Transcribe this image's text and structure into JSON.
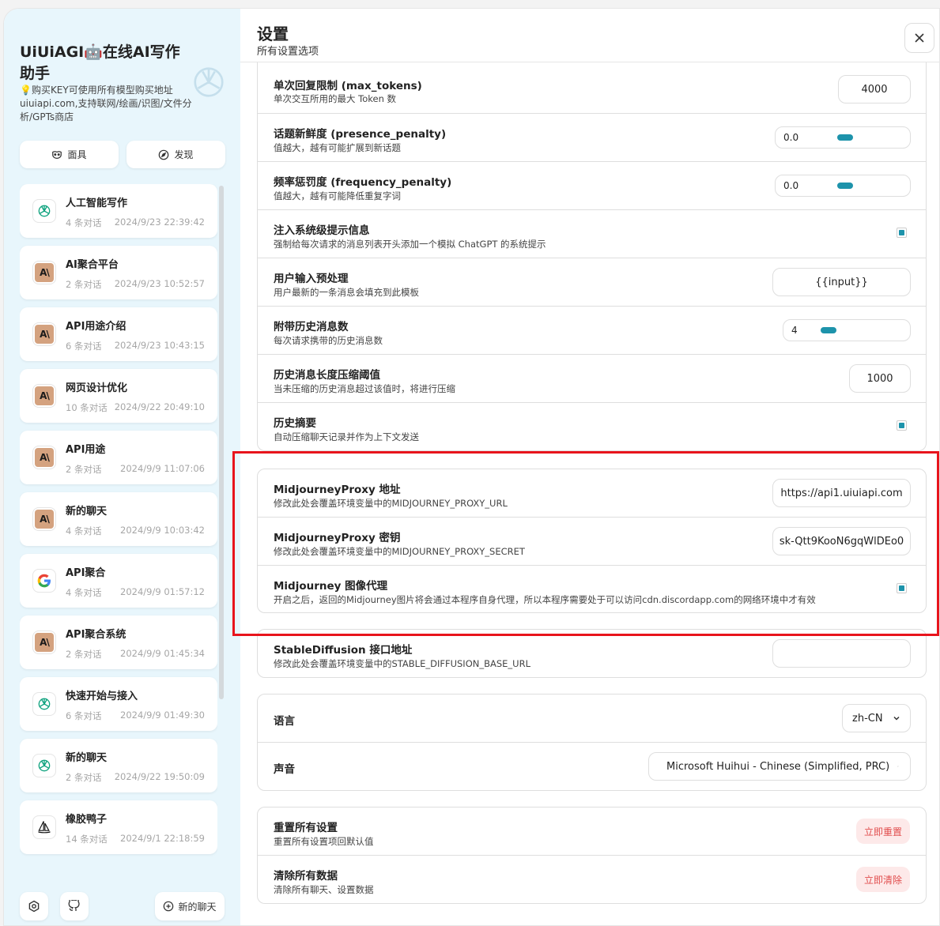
{
  "sidebar": {
    "brand_title": "UiUiAGI🤖在线AI写作助手",
    "brand_sub": "💡购买KEY可使用所有模型购买地址uiuiapi.com,支持联网/绘画/识图/文件分析/GPTs商店",
    "mask_label": "面具",
    "discover_label": "发现",
    "new_chat_label": "新的聊天",
    "chats": [
      {
        "title": "人工智能写作",
        "count": "4 条对话",
        "date": "2024/9/23 22:39:42",
        "icon": "openai-icon"
      },
      {
        "title": "AI聚合平台",
        "count": "2 条对话",
        "date": "2024/9/23 10:52:57",
        "icon": "anthropic-icon"
      },
      {
        "title": "API用途介绍",
        "count": "6 条对话",
        "date": "2024/9/23 10:43:15",
        "icon": "anthropic-icon"
      },
      {
        "title": "网页设计优化",
        "count": "10 条对话",
        "date": "2024/9/22 20:49:10",
        "icon": "anthropic-icon"
      },
      {
        "title": "API用途",
        "count": "2 条对话",
        "date": "2024/9/9 11:07:06",
        "icon": "anthropic-icon"
      },
      {
        "title": "新的聊天",
        "count": "4 条对话",
        "date": "2024/9/9 10:03:42",
        "icon": "anthropic-icon"
      },
      {
        "title": "API聚合",
        "count": "4 条对话",
        "date": "2024/9/9 01:57:12",
        "icon": "google-icon"
      },
      {
        "title": "API聚合系统",
        "count": "2 条对话",
        "date": "2024/9/9 01:45:34",
        "icon": "anthropic-icon"
      },
      {
        "title": "快速开始与接入",
        "count": "6 条对话",
        "date": "2024/9/9 01:49:30",
        "icon": "openai-icon"
      },
      {
        "title": "新的聊天",
        "count": "2 条对话",
        "date": "2024/9/22 19:50:09",
        "icon": "openai-icon"
      },
      {
        "title": "橡胶鸭子",
        "count": "14 条对话",
        "date": "2024/9/1 22:18:59",
        "icon": "midjourney-icon"
      }
    ]
  },
  "header": {
    "title": "设置",
    "subtitle": "所有设置选项"
  },
  "settings": {
    "max_tokens": {
      "title": "单次回复限制 (max_tokens)",
      "sub": "单次交互所用的最大 Token 数",
      "value": "4000"
    },
    "presence_penalty": {
      "title": "话题新鲜度 (presence_penalty)",
      "sub": "值越大，越有可能扩展到新话题",
      "value": "0.0",
      "level": 0.5
    },
    "frequency_penalty": {
      "title": "频率惩罚度 (frequency_penalty)",
      "sub": "值越大，越有可能降低重复字词",
      "value": "0.0",
      "level": 0.5
    },
    "inject_system": {
      "title": "注入系统级提示信息",
      "sub": "强制给每次请求的消息列表开头添加一个模拟 ChatGPT 的系统提示"
    },
    "input_template": {
      "title": "用户输入预处理",
      "sub": "用户最新的一条消息会填充到此模板",
      "value": "{{input}}"
    },
    "history_count": {
      "title": "附带历史消息数",
      "sub": "每次请求携带的历史消息数",
      "value": "4",
      "level": 0.125
    },
    "compress_threshold": {
      "title": "历史消息长度压缩阈值",
      "sub": "当未压缩的历史消息超过该值时，将进行压缩",
      "value": "1000"
    },
    "history_summary": {
      "title": "历史摘要",
      "sub": "自动压缩聊天记录并作为上下文发送"
    },
    "mj_proxy_url": {
      "title": "MidjourneyProxy 地址",
      "sub": "修改此处会覆盖环境变量中的MIDJOURNEY_PROXY_URL",
      "value": "https://api1.uiuiapi.com"
    },
    "mj_proxy_secret": {
      "title": "MidjourneyProxy 密钥",
      "sub": "修改此处会覆盖环境变量中的MIDJOURNEY_PROXY_SECRET",
      "value": "sk-Qtt9KooN6gqWlDEo0"
    },
    "mj_image_proxy": {
      "title": "Midjourney 图像代理",
      "sub": "开启之后，返回的Midjourney图片将会通过本程序自身代理，所以本程序需要处于可以访问cdn.discordapp.com的网络环境中才有效"
    },
    "sd_url": {
      "title": "StableDiffusion 接口地址",
      "sub": "修改此处会覆盖环境变量中的STABLE_DIFFUSION_BASE_URL",
      "value": ""
    },
    "language": {
      "title": "语言",
      "value": "zh-CN"
    },
    "voice": {
      "title": "声音",
      "value": "Microsoft Huihui - Chinese (Simplified, PRC)"
    },
    "reset": {
      "title": "重置所有设置",
      "sub": "重置所有设置项回默认值",
      "button": "立即重置"
    },
    "clear": {
      "title": "清除所有数据",
      "sub": "清除所有聊天、设置数据",
      "button": "立即清除"
    }
  },
  "colors": {
    "accent": "#1d93ab",
    "sidebar_bg": "#e8f6fc",
    "danger": "#e14d4d",
    "highlight": "#e8141c"
  }
}
